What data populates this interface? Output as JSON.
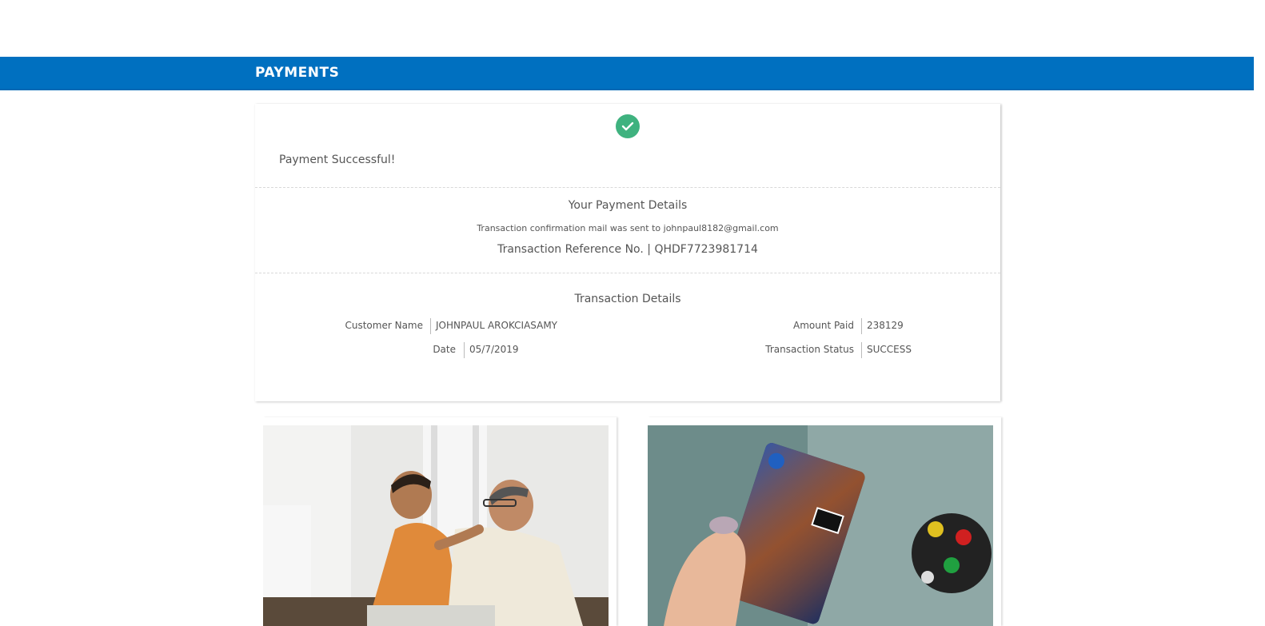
{
  "header": {
    "title": "PAYMENTS"
  },
  "status": {
    "message": "Payment Successful!",
    "icon": "check-circle-icon",
    "color": "#3fb27f"
  },
  "payment_details": {
    "heading": "Your Payment Details",
    "confirmation_text": "Transaction confirmation mail was sent to johnpaul8182@gmail.com",
    "reference_label": "Transaction Reference No.",
    "reference_separator": "|",
    "reference_value": "QHDF7723981714"
  },
  "transaction_details": {
    "heading": "Transaction Details",
    "customer_name_label": "Customer Name",
    "customer_name_value": "JOHNPAUL AROKCIASAMY",
    "date_label": "Date",
    "date_value": "05/7/2019",
    "amount_label": "Amount Paid",
    "amount_value": "238129",
    "status_label": "Transaction Status",
    "status_value": "SUCCESS"
  },
  "promos": [
    {
      "image": "two-men-laughing-photo"
    },
    {
      "image": "emi-card-payment-photo"
    }
  ],
  "colors": {
    "banner": "#0070c0",
    "success": "#3fb27f"
  }
}
